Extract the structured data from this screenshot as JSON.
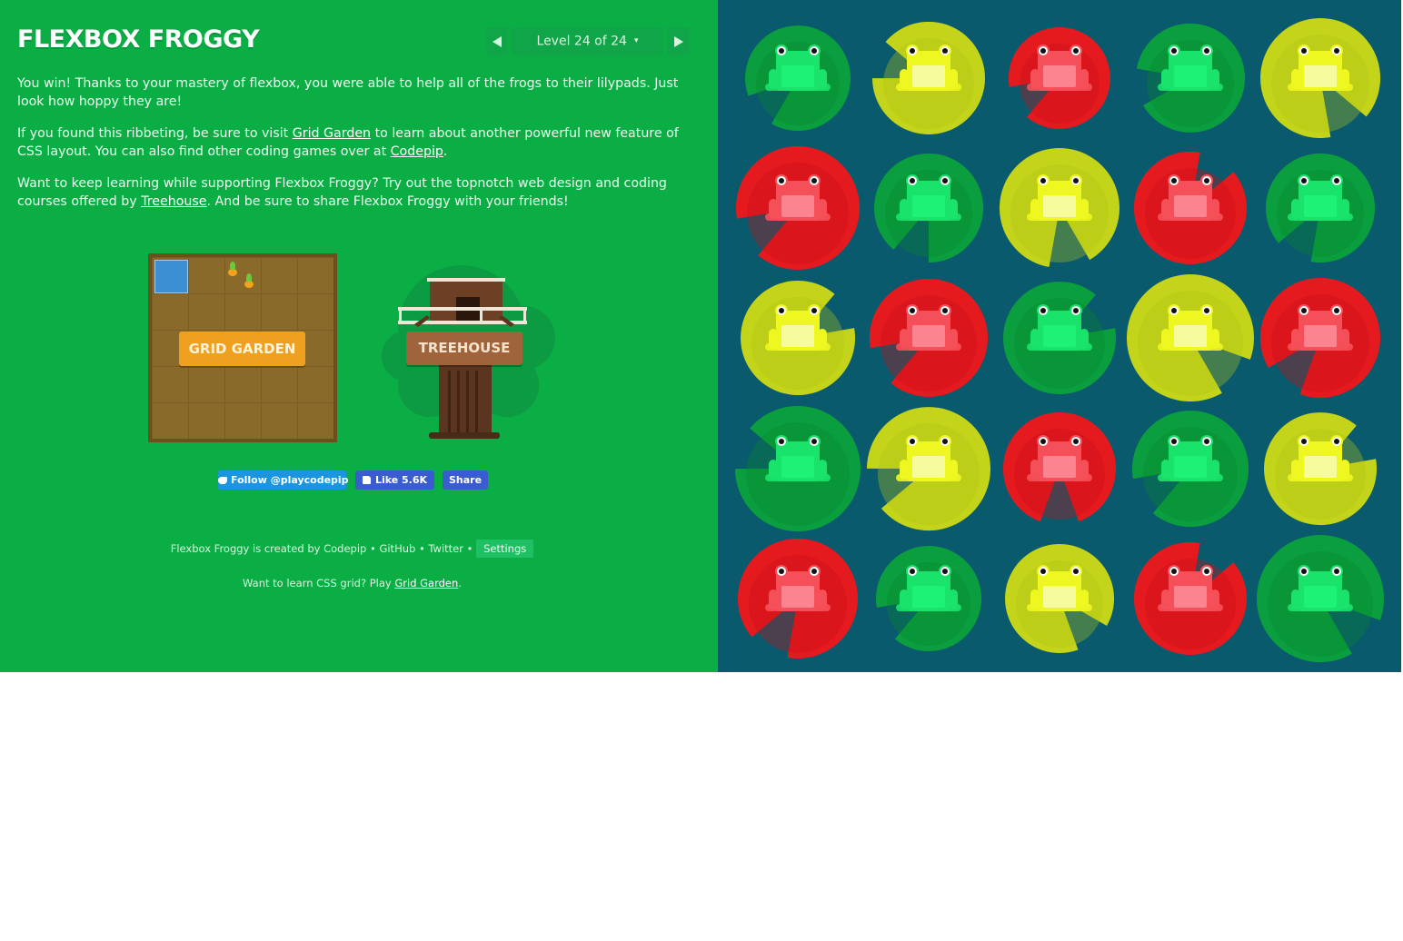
{
  "header": {
    "title": "FLEXBOX FROGGY",
    "level_text": "Level 24 of 24",
    "level_caret": "▾",
    "colors": {
      "accent": "#0bae45",
      "board": "#0a5a6d"
    }
  },
  "content": {
    "para1": "You win! Thanks to your mastery of flexbox, you were able to help all of the frogs to their lilypads. Just look how hoppy they are!",
    "para2_before": "If you found this ribbeting, be sure to visit ",
    "para2_link1": "Grid Garden",
    "para2_mid": " to learn about another powerful new feature of CSS layout. You can also find other coding games over at ",
    "para2_link2": "Codepip",
    "para2_after": ".",
    "para3_before": "Want to keep learning while supporting Flexbox Froggy? Try out the topnotch web design and coding courses offered by ",
    "para3_link": "Treehouse",
    "para3_after": ". And be sure to share Flexbox Froggy with your friends!"
  },
  "promos": {
    "grid_garden_label": "GRID GARDEN",
    "treehouse_label": "TREEHOUSE"
  },
  "social": {
    "twitter": "Follow @playcodepip",
    "fb_like": "Like 5.6K",
    "fb_share": "Share"
  },
  "footer": {
    "created_by": "Flexbox Froggy is created by ",
    "codepip": "Codepip",
    "github": "GitHub",
    "twitter": "Twitter",
    "separator": " • ",
    "settings": "Settings",
    "grid_prefix": "Want to learn CSS grid? Play ",
    "grid_link": "Grid Garden",
    "grid_suffix": "."
  },
  "board": {
    "progress": 0.22,
    "rows": [
      [
        "green",
        "yellow",
        "red",
        "green",
        "yellow"
      ],
      [
        "red",
        "green",
        "yellow",
        "red",
        "green"
      ],
      [
        "yellow",
        "red",
        "green",
        "yellow",
        "red"
      ],
      [
        "green",
        "yellow",
        "red",
        "green",
        "yellow"
      ],
      [
        "red",
        "green",
        "yellow",
        "red",
        "green"
      ]
    ],
    "palette": {
      "green": {
        "pad": "#0b9e3e",
        "padDark": "#07882f",
        "frog": "#19e36a",
        "belly": "#1df276"
      },
      "yellow": {
        "pad": "#c3d41a",
        "padDark": "#b2c416",
        "frog": "#eef720",
        "belly": "#f6fb9e"
      },
      "red": {
        "pad": "#e41a1f",
        "padDark": "#c91016",
        "frog": "#f5505a",
        "belly": "#fb8490"
      }
    }
  }
}
